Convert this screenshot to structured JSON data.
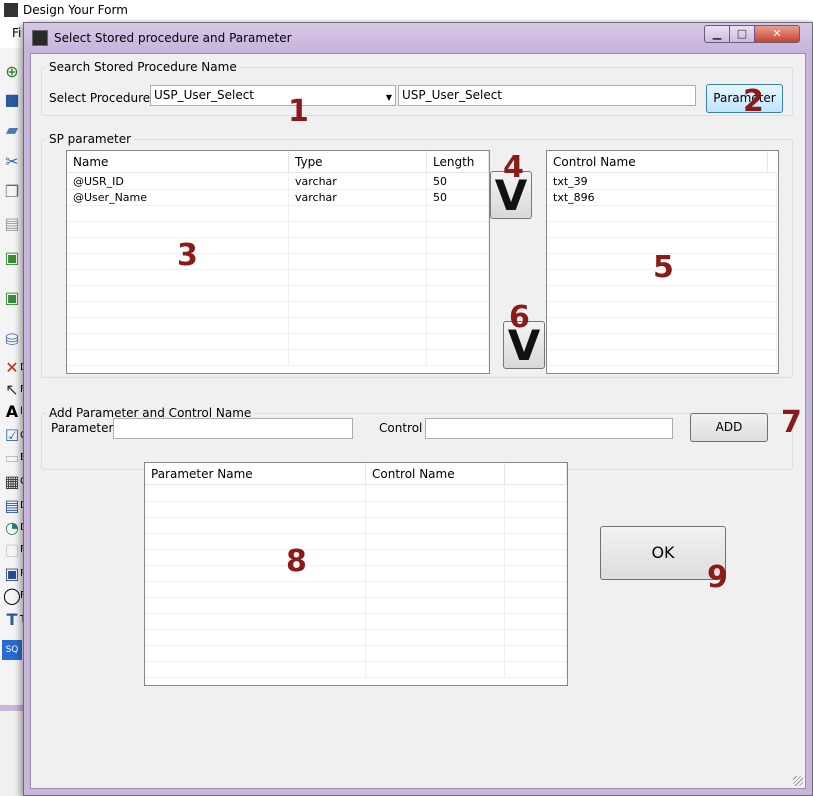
{
  "background": {
    "title": "Design  Your Form",
    "menu_first": "Fi",
    "toolbox_labels": [
      "D",
      "F",
      "l",
      "C",
      "E",
      "C",
      "D",
      "D",
      "F",
      "P",
      "F",
      "T"
    ]
  },
  "dialog": {
    "title": "Select Stored procedure and Parameter",
    "min_glyph": "▁",
    "max_glyph": "□",
    "close_glyph": "✕"
  },
  "search_group": {
    "legend": "Search Stored Procedure Name",
    "select_label": "Select Procedure",
    "combo_value": "USP_User_Select",
    "combo_arrow": "▼",
    "text_value": "USP_User_Select",
    "parameter_button": "Parameter"
  },
  "sp_group": {
    "legend": "SP parameter",
    "param_grid": {
      "columns": [
        "Name",
        "Type",
        "Length"
      ],
      "rows": [
        [
          "@USR_ID",
          "varchar",
          "50"
        ],
        [
          "@User_Name",
          "varchar",
          "50"
        ]
      ]
    },
    "control_grid": {
      "columns": [
        "Control Name"
      ],
      "rows": [
        [
          "txt_39"
        ],
        [
          "txt_896"
        ]
      ]
    },
    "move_button_1": "V",
    "move_button_2": "V"
  },
  "add_group": {
    "legend": "Add Parameter and Control  Name",
    "parameter_label": "Parameter",
    "parameter_value": "",
    "control_label": "Control",
    "control_value": "",
    "add_button": "ADD"
  },
  "result_grid": {
    "columns": [
      "Parameter Name",
      "Control Name"
    ],
    "rows": []
  },
  "ok_button": "OK",
  "markers": [
    "1",
    "2",
    "3",
    "4",
    "5",
    "6",
    "7",
    "8",
    "9"
  ]
}
